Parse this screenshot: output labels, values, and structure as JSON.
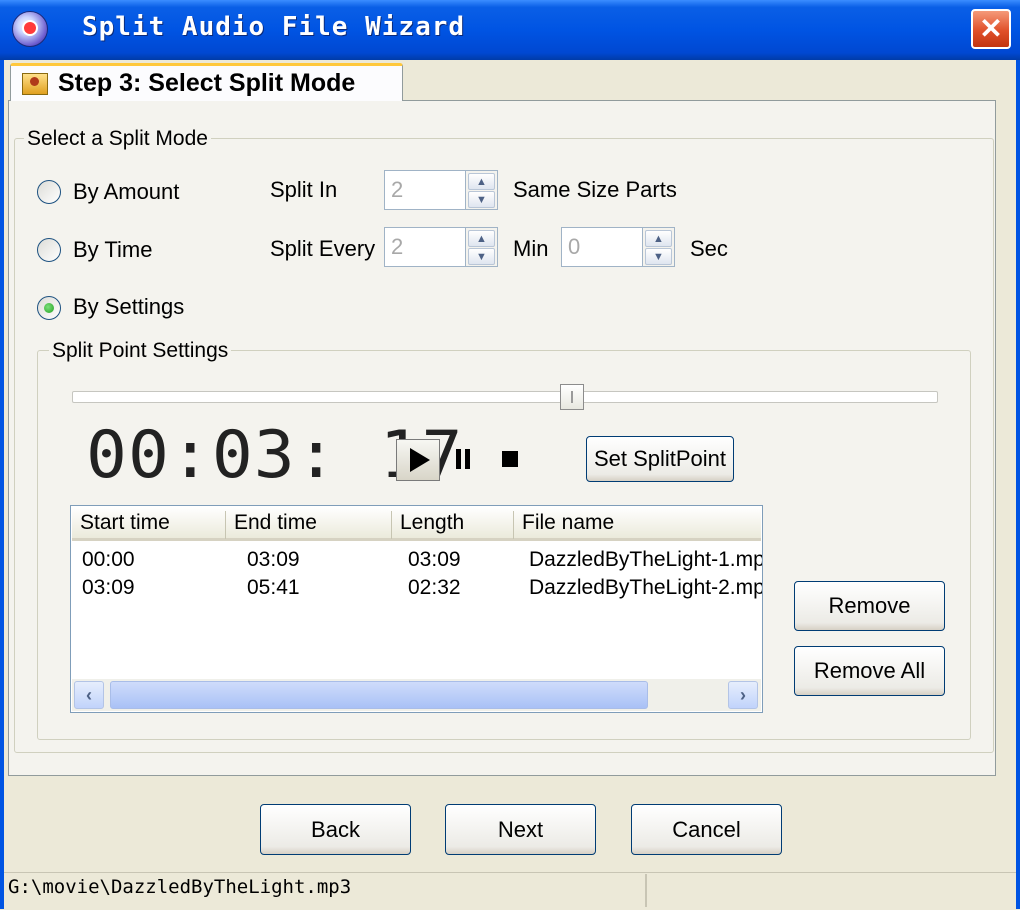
{
  "window": {
    "title": "Split Audio File Wizard",
    "close_glyph": "✕"
  },
  "tab": {
    "label": "Step 3: Select Split Mode"
  },
  "split_mode": {
    "legend": "Select a  Split Mode",
    "selected": "by_settings",
    "by_amount": {
      "label": "By Amount",
      "split_in_label": "Split In",
      "split_in_value": "2",
      "parts_label": "Same Size Parts"
    },
    "by_time": {
      "label": "By Time",
      "split_every_label": "Split Every",
      "min_value": "2",
      "min_label": "Min",
      "sec_value": "0",
      "sec_label": "Sec"
    },
    "by_settings": {
      "label": "By Settings"
    }
  },
  "split_point": {
    "legend": "Split Point Settings",
    "slider_position": 0.58,
    "time_display": "00:03: 17",
    "set_button": "Set SplitPoint"
  },
  "list": {
    "columns": [
      "Start time",
      "End time",
      "Length",
      "File name"
    ],
    "rows": [
      [
        "00:00",
        "03:09",
        "03:09",
        "DazzledByTheLight-1.mp"
      ],
      [
        "03:09",
        "05:41",
        "02:32",
        "DazzledByTheLight-2.mp"
      ]
    ]
  },
  "actions": {
    "remove": "Remove",
    "remove_all": "Remove All"
  },
  "nav": {
    "back": "Back",
    "next": "Next",
    "cancel": "Cancel"
  },
  "status": {
    "path": "G:\\movie\\DazzledByTheLight.mp3"
  }
}
